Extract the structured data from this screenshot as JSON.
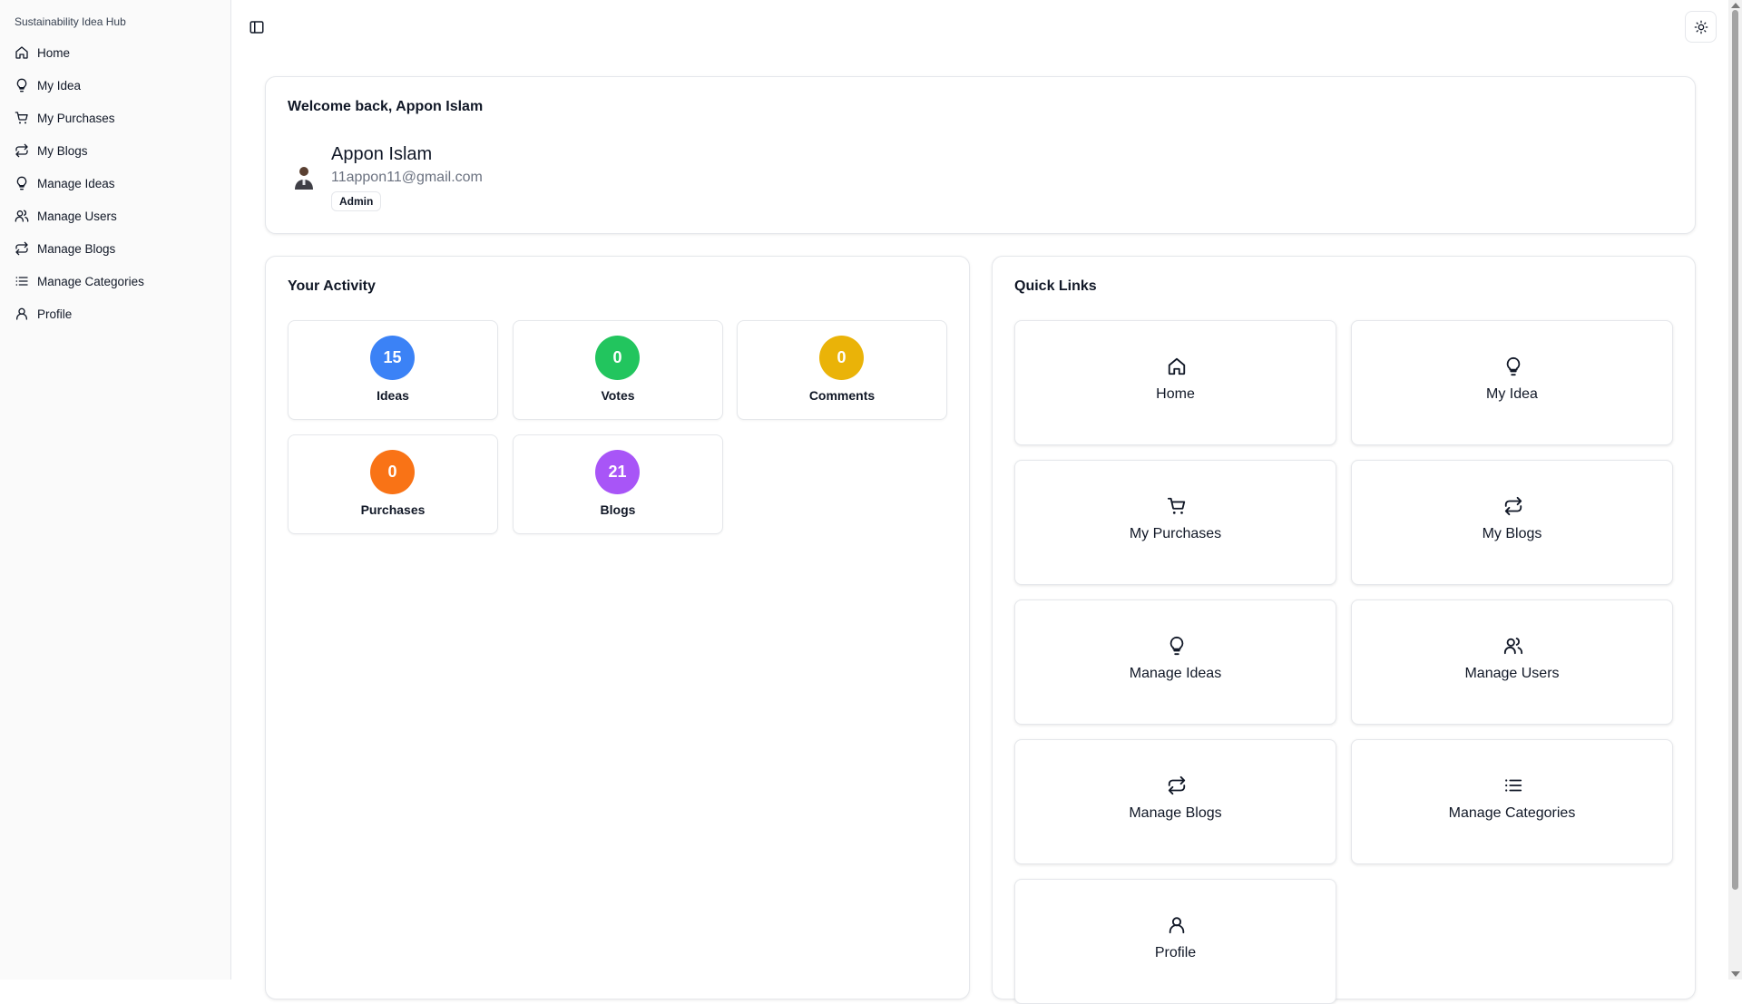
{
  "app": {
    "title": "Sustainability Idea Hub"
  },
  "sidebar": {
    "items": [
      {
        "label": "Home",
        "icon": "home-icon"
      },
      {
        "label": "My Idea",
        "icon": "lightbulb-icon"
      },
      {
        "label": "My Purchases",
        "icon": "cart-icon"
      },
      {
        "label": "My Blogs",
        "icon": "repeat-icon"
      },
      {
        "label": "Manage Ideas",
        "icon": "lightbulb-icon"
      },
      {
        "label": "Manage Users",
        "icon": "users-icon"
      },
      {
        "label": "Manage Blogs",
        "icon": "repeat-icon"
      },
      {
        "label": "Manage Categories",
        "icon": "list-icon"
      },
      {
        "label": "Profile",
        "icon": "user-icon"
      }
    ]
  },
  "header": {
    "sidebar_toggle_icon": "sidebar-toggle-icon",
    "theme_icon": "sun-icon"
  },
  "welcome": {
    "title": "Welcome back, Appon Islam",
    "user": {
      "name": "Appon Islam",
      "email": "11appon11@gmail.com",
      "role": "Admin"
    }
  },
  "activity": {
    "title": "Your Activity",
    "stats": [
      {
        "label": "Ideas",
        "value": "15",
        "color": "#3b82f6"
      },
      {
        "label": "Votes",
        "value": "0",
        "color": "#22c55e"
      },
      {
        "label": "Comments",
        "value": "0",
        "color": "#eab308"
      },
      {
        "label": "Purchases",
        "value": "0",
        "color": "#f97316"
      },
      {
        "label": "Blogs",
        "value": "21",
        "color": "#a855f7"
      }
    ]
  },
  "quick_links": {
    "title": "Quick Links",
    "items": [
      {
        "label": "Home",
        "icon": "home-icon"
      },
      {
        "label": "My Idea",
        "icon": "lightbulb-icon"
      },
      {
        "label": "My Purchases",
        "icon": "cart-icon"
      },
      {
        "label": "My Blogs",
        "icon": "repeat-icon"
      },
      {
        "label": "Manage Ideas",
        "icon": "lightbulb-icon"
      },
      {
        "label": "Manage Users",
        "icon": "users-icon"
      },
      {
        "label": "Manage Blogs",
        "icon": "repeat-icon"
      },
      {
        "label": "Manage Categories",
        "icon": "list-icon"
      },
      {
        "label": "Profile",
        "icon": "user-icon"
      }
    ]
  }
}
